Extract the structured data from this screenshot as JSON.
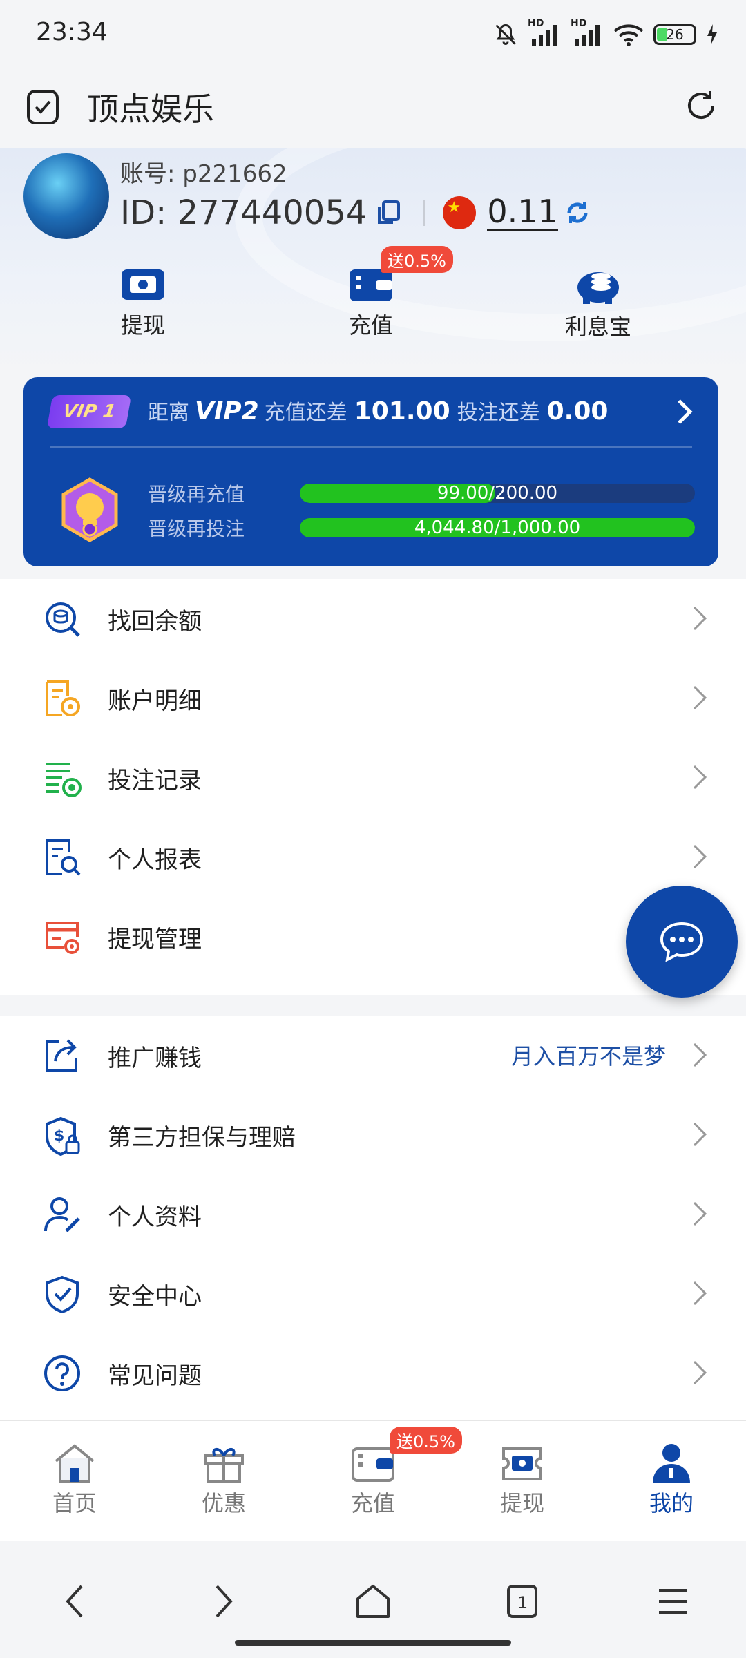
{
  "status_bar": {
    "time": "23:34",
    "battery": "26",
    "hd1": "HD",
    "hd2": "HD"
  },
  "app_bar": {
    "title": "顶点娱乐"
  },
  "profile": {
    "account_label": "账号: p221662",
    "id_label": "ID: 277440054",
    "balance": "0.11"
  },
  "quick_actions": [
    {
      "label": "提现",
      "icon": "withdraw-icon"
    },
    {
      "label": "充值",
      "icon": "wallet-icon",
      "badge": "送0.5%"
    },
    {
      "label": "利息宝",
      "icon": "piggy-bank-icon"
    }
  ],
  "vip": {
    "level": "VIP 1",
    "text_distance": "距离",
    "next_level": "VIP2",
    "text_recharge": "充值还差",
    "recharge_needed": "101.00",
    "text_bet": "投注还差",
    "bet_needed": "0.00",
    "progress": [
      {
        "label": "晋级再充值",
        "value": "99.00/200.00",
        "fraction": 0.495
      },
      {
        "label": "晋级再投注",
        "value": "4,044.80/1,000.00",
        "fraction": 1.0
      }
    ]
  },
  "menu_group_1": [
    {
      "label": "找回余额",
      "icon": "balance-search-icon"
    },
    {
      "label": "账户明细",
      "icon": "account-detail-icon"
    },
    {
      "label": "投注记录",
      "icon": "bet-record-icon"
    },
    {
      "label": "个人报表",
      "icon": "report-icon"
    },
    {
      "label": "提现管理",
      "icon": "withdraw-manage-icon"
    }
  ],
  "menu_group_2": [
    {
      "label": "推广赚钱",
      "icon": "share-icon",
      "extra": "月入百万不是梦"
    },
    {
      "label": "第三方担保与理赔",
      "icon": "guarantee-icon"
    },
    {
      "label": "个人资料",
      "icon": "profile-icon"
    },
    {
      "label": "安全中心",
      "icon": "security-icon"
    },
    {
      "label": "常见问题",
      "icon": "help-icon"
    }
  ],
  "tab_bar": [
    {
      "label": "首页",
      "icon": "home-icon"
    },
    {
      "label": "优惠",
      "icon": "gift-icon"
    },
    {
      "label": "充值",
      "icon": "wallet-icon",
      "badge": "送0.5%"
    },
    {
      "label": "提现",
      "icon": "withdraw-icon"
    },
    {
      "label": "我的",
      "icon": "user-icon",
      "active": true
    }
  ],
  "colors": {
    "primary": "#0e47a8",
    "progress": "#22c21f",
    "badge": "#f04a3a"
  }
}
